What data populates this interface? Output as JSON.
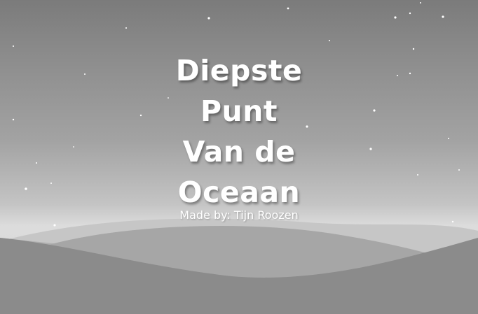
{
  "title": {
    "lines": [
      "Diepste",
      "Punt",
      "Van de",
      "Oceaan"
    ]
  },
  "credit": "Made by: Tijn Roozen",
  "colors": {
    "sky_top": "#7b7b7b",
    "sky_horizon": "#dcdcdc",
    "hill_far": "#c2c2c2",
    "hill_mid": "#a9a9a9",
    "hill_near": "#8a8a8a",
    "title_text": "#ffffff"
  }
}
